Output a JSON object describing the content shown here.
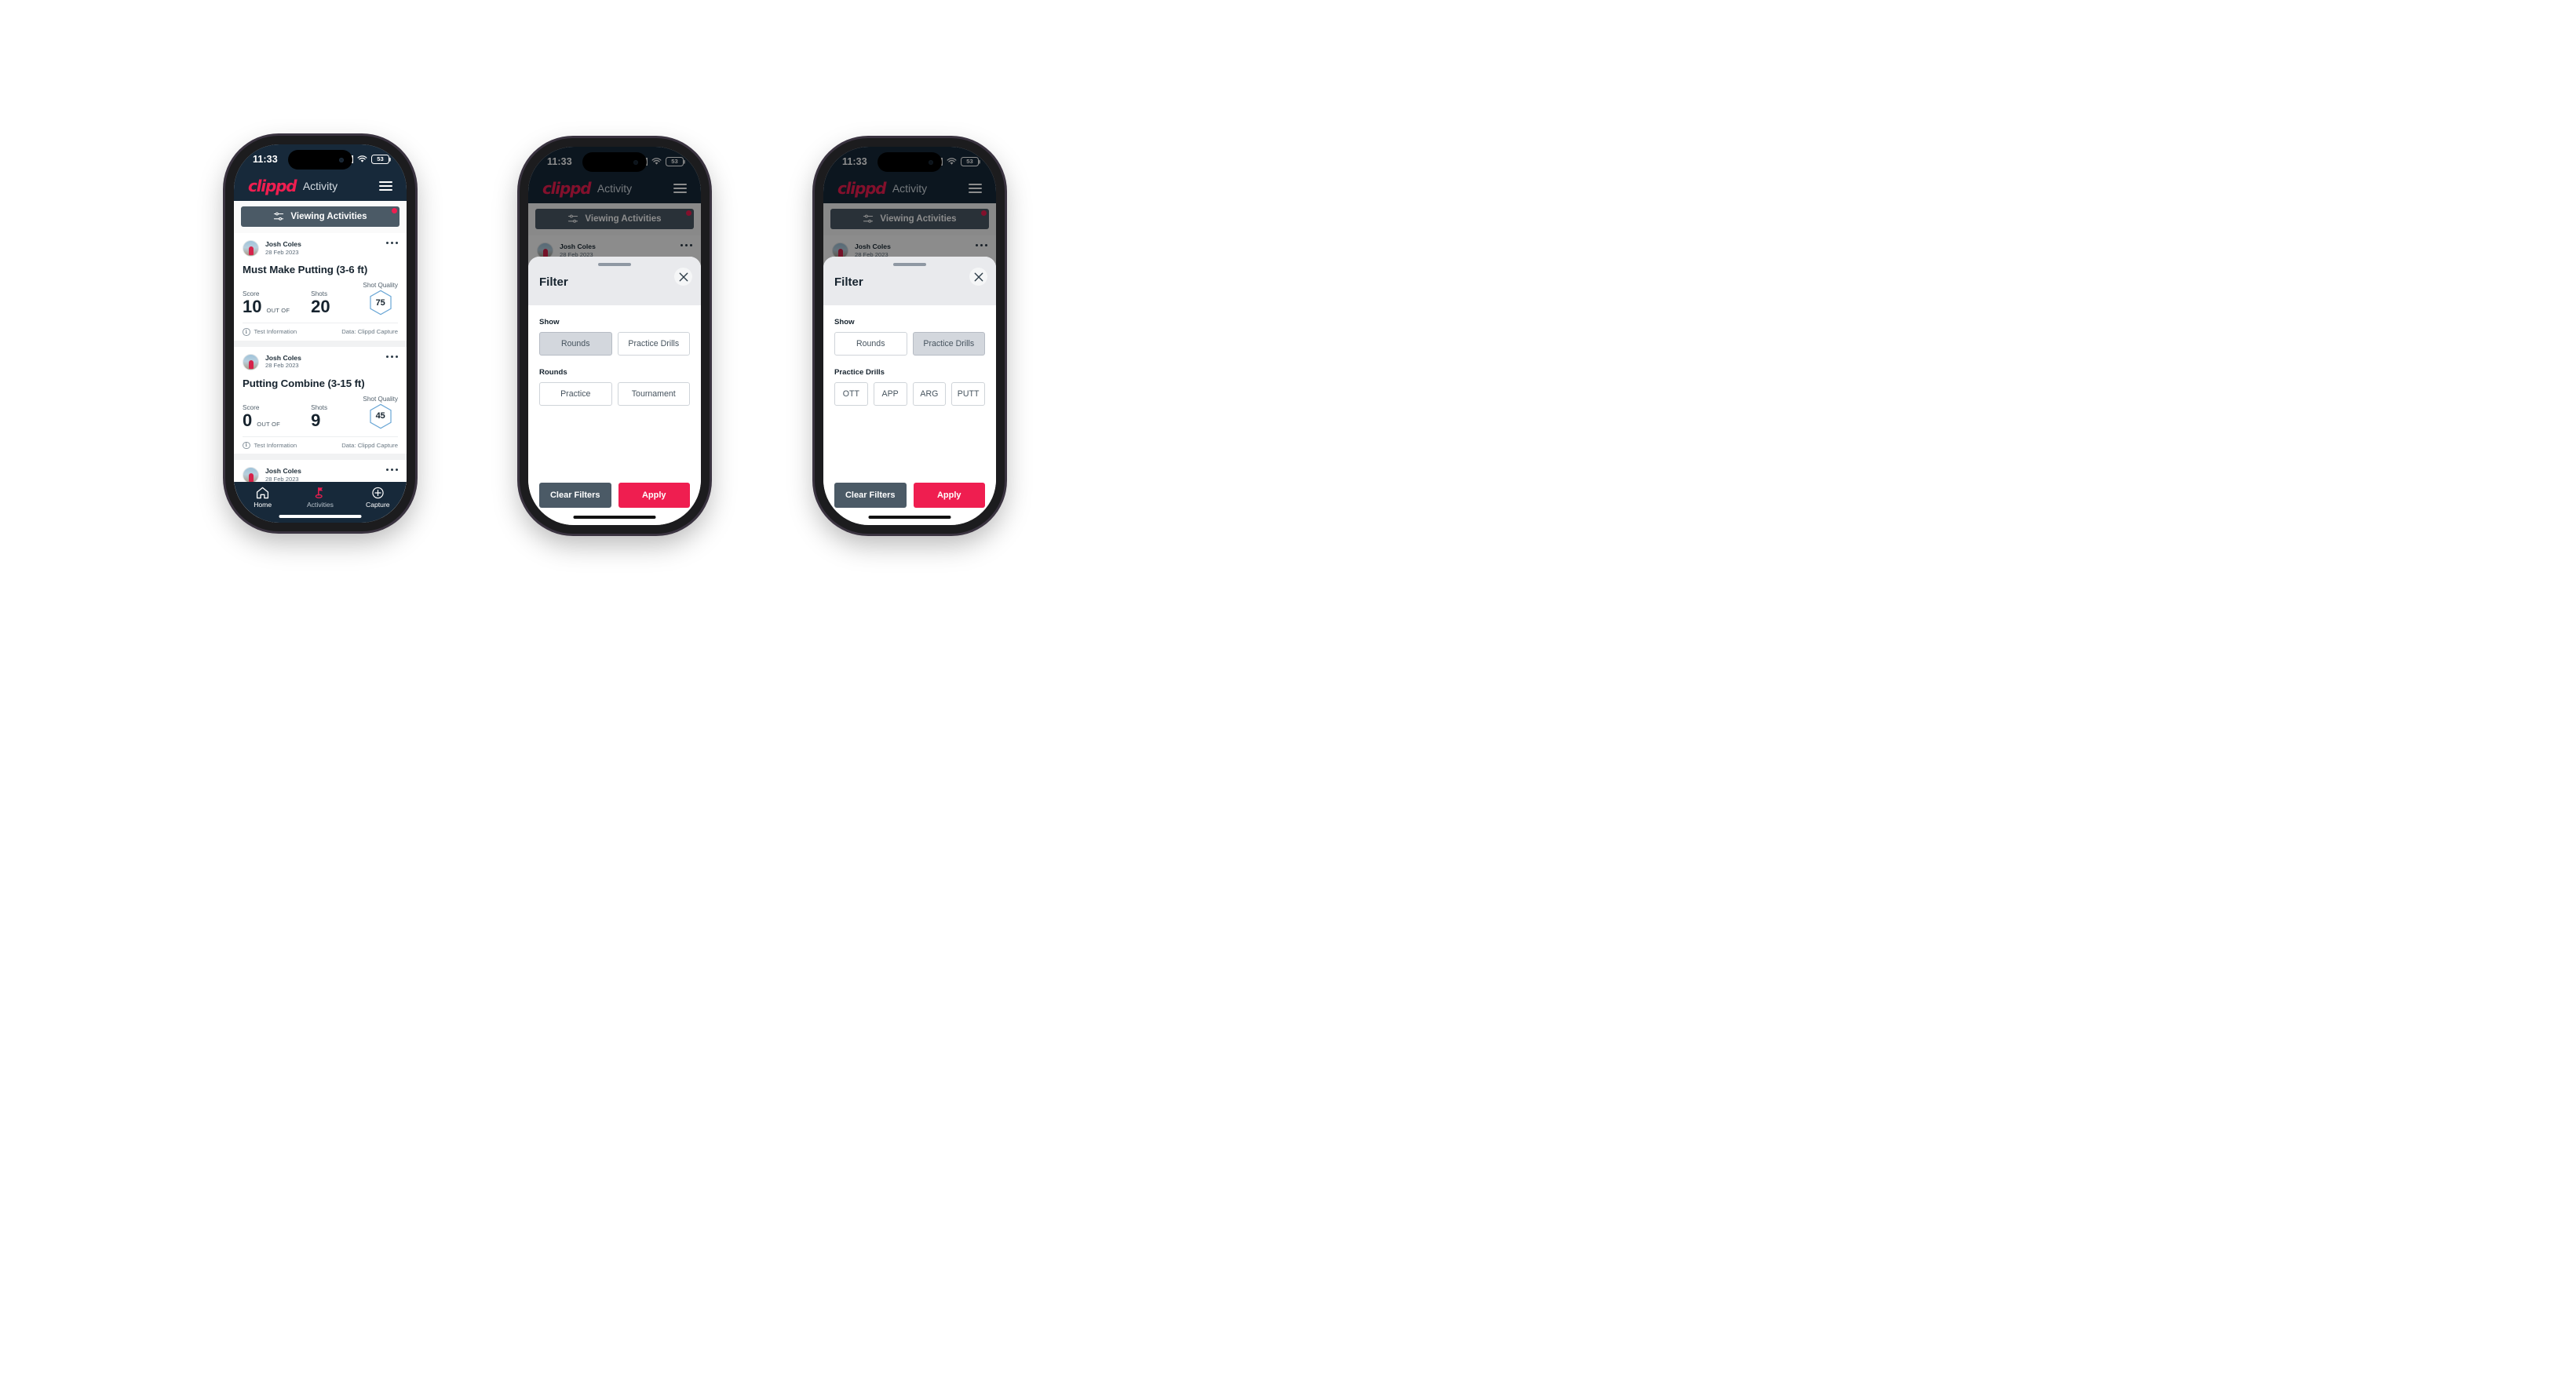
{
  "status_bar": {
    "time": "11:33",
    "battery": "53",
    "signal_icon": "cellular-signal-icon",
    "wifi_icon": "wifi-icon",
    "battery_icon": "battery-icon"
  },
  "header": {
    "logo_text": "clippd",
    "title": "Activity",
    "menu_icon": "hamburger-menu-icon"
  },
  "filter_bar": {
    "label": "Viewing Activities",
    "icon": "filter-sliders-icon",
    "badge": "notification-dot"
  },
  "feed": {
    "cards": [
      {
        "author": "Josh Coles",
        "date": "28 Feb 2023",
        "title": "Must Make Putting (3-6 ft)",
        "score_label": "Score",
        "score_value": "10",
        "out_of": "OUT OF",
        "shots_label": "Shots",
        "shots_value": "20",
        "quality_label": "Shot Quality",
        "quality_value": "75",
        "footer_left": "Test Information",
        "footer_right": "Data: Clippd Capture"
      },
      {
        "author": "Josh Coles",
        "date": "28 Feb 2023",
        "title": "Putting Combine (3-15 ft)",
        "score_label": "Score",
        "score_value": "0",
        "out_of": "OUT OF",
        "shots_label": "Shots",
        "shots_value": "9",
        "quality_label": "Shot Quality",
        "quality_value": "45",
        "footer_left": "Test Information",
        "footer_right": "Data: Clippd Capture"
      },
      {
        "author": "Josh Coles",
        "date": "28 Feb 2023"
      }
    ]
  },
  "bottom_nav": {
    "items": [
      {
        "label": "Home",
        "icon": "home-icon"
      },
      {
        "label": "Activities",
        "icon": "golf-flag-icon"
      },
      {
        "label": "Capture",
        "icon": "plus-circle-icon"
      }
    ]
  },
  "filter_sheet": {
    "title": "Filter",
    "close_icon": "close-icon",
    "show_label": "Show",
    "show_options": [
      "Rounds",
      "Practice Drills"
    ],
    "rounds_label": "Rounds",
    "rounds_options": [
      "Practice",
      "Tournament"
    ],
    "drills_label": "Practice Drills",
    "drills_options": [
      "OTT",
      "APP",
      "ARG",
      "PUTT"
    ],
    "clear_label": "Clear Filters",
    "apply_label": "Apply"
  },
  "colors": {
    "brand_pink": "#ef1e50",
    "header_navy": "#17293a",
    "slate": "#4b5a66",
    "chip_selected": "#d3d7dd",
    "hex_outline": "#6ba7d6"
  }
}
